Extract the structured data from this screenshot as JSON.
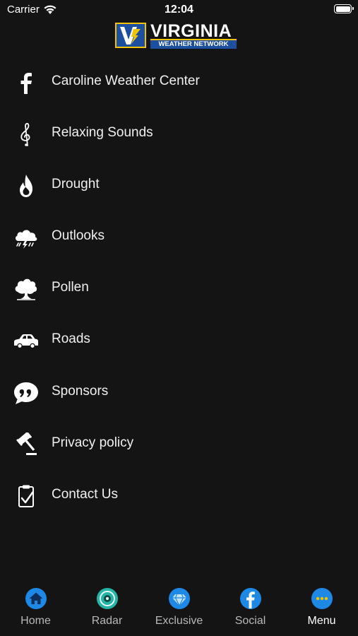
{
  "status_bar": {
    "carrier": "Carrier",
    "time": "12:04"
  },
  "logo": {
    "title": "VIRGINIA",
    "subtitle": "WEATHER NETWORK"
  },
  "menu": {
    "items": [
      {
        "label": "Caroline Weather Center",
        "icon": "facebook-icon"
      },
      {
        "label": "Relaxing Sounds",
        "icon": "treble-clef-icon"
      },
      {
        "label": "Drought",
        "icon": "flame-icon"
      },
      {
        "label": "Outlooks",
        "icon": "storm-cloud-icon"
      },
      {
        "label": "Pollen",
        "icon": "tree-icon"
      },
      {
        "label": "Roads",
        "icon": "car-icon"
      },
      {
        "label": "Sponsors",
        "icon": "quote-bubble-icon"
      },
      {
        "label": "Privacy policy",
        "icon": "gavel-icon"
      },
      {
        "label": "Contact Us",
        "icon": "clipboard-check-icon"
      }
    ]
  },
  "tabs": {
    "items": [
      {
        "label": "Home",
        "icon": "home-icon"
      },
      {
        "label": "Radar",
        "icon": "radar-icon"
      },
      {
        "label": "Exclusive",
        "icon": "diamond-icon"
      },
      {
        "label": "Social",
        "icon": "facebook-icon"
      },
      {
        "label": "Menu",
        "icon": "more-icon"
      }
    ],
    "active": "Menu"
  },
  "colors": {
    "background": "#141414",
    "accent": "#1e88e5",
    "radar": "#27b3a5"
  }
}
